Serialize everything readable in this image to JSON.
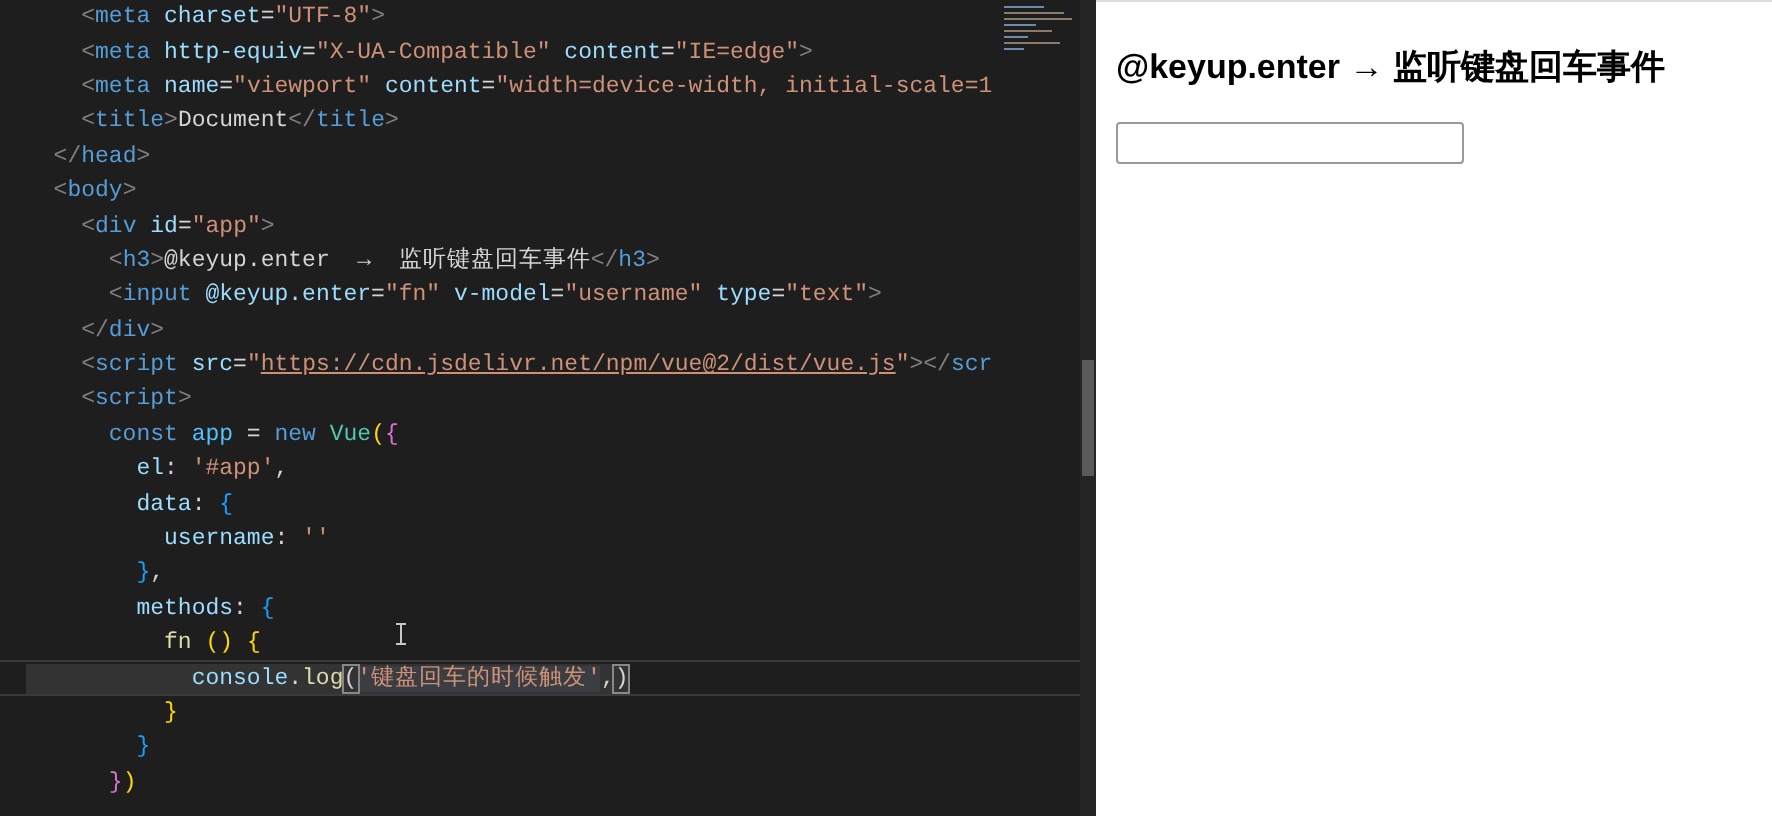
{
  "editor": {
    "lines": [
      {
        "current": false,
        "tokens": [
          {
            "kind": "punct",
            "text": "    <"
          },
          {
            "kind": "tag",
            "text": "meta"
          },
          {
            "kind": "attr",
            "text": " charset"
          },
          {
            "kind": "text",
            "text": "="
          },
          {
            "kind": "str",
            "text": "\"UTF-8\""
          },
          {
            "kind": "punct",
            "text": ">"
          }
        ]
      },
      {
        "current": false,
        "tokens": [
          {
            "kind": "punct",
            "text": "    <"
          },
          {
            "kind": "tag",
            "text": "meta"
          },
          {
            "kind": "attr",
            "text": " http-equiv"
          },
          {
            "kind": "text",
            "text": "="
          },
          {
            "kind": "str",
            "text": "\"X-UA-Compatible\""
          },
          {
            "kind": "attr",
            "text": " content"
          },
          {
            "kind": "text",
            "text": "="
          },
          {
            "kind": "str",
            "text": "\"IE=edge\""
          },
          {
            "kind": "punct",
            "text": ">"
          }
        ]
      },
      {
        "current": false,
        "tokens": [
          {
            "kind": "punct",
            "text": "    <"
          },
          {
            "kind": "tag",
            "text": "meta"
          },
          {
            "kind": "attr",
            "text": " name"
          },
          {
            "kind": "text",
            "text": "="
          },
          {
            "kind": "str",
            "text": "\"viewport\""
          },
          {
            "kind": "attr",
            "text": " content"
          },
          {
            "kind": "text",
            "text": "="
          },
          {
            "kind": "str",
            "text": "\"width=device-width, initial-scale=1"
          }
        ]
      },
      {
        "current": false,
        "tokens": [
          {
            "kind": "punct",
            "text": "    <"
          },
          {
            "kind": "tag",
            "text": "title"
          },
          {
            "kind": "punct",
            "text": ">"
          },
          {
            "kind": "text",
            "text": "Document"
          },
          {
            "kind": "punct",
            "text": "</"
          },
          {
            "kind": "tag",
            "text": "title"
          },
          {
            "kind": "punct",
            "text": ">"
          }
        ]
      },
      {
        "current": false,
        "tokens": [
          {
            "kind": "punct",
            "text": "  </"
          },
          {
            "kind": "tag",
            "text": "head"
          },
          {
            "kind": "punct",
            "text": ">"
          }
        ]
      },
      {
        "current": false,
        "tokens": [
          {
            "kind": "punct",
            "text": "  <"
          },
          {
            "kind": "tag",
            "text": "body"
          },
          {
            "kind": "punct",
            "text": ">"
          }
        ]
      },
      {
        "current": false,
        "tokens": [
          {
            "kind": "punct",
            "text": "    <"
          },
          {
            "kind": "tag",
            "text": "div"
          },
          {
            "kind": "attr",
            "text": " id"
          },
          {
            "kind": "text",
            "text": "="
          },
          {
            "kind": "str",
            "text": "\"app\""
          },
          {
            "kind": "punct",
            "text": ">"
          }
        ]
      },
      {
        "current": false,
        "tokens": [
          {
            "kind": "punct",
            "text": "      <"
          },
          {
            "kind": "tag",
            "text": "h3"
          },
          {
            "kind": "punct",
            "text": ">"
          },
          {
            "kind": "text",
            "text": "@keyup.enter  →  监听键盘回车事件"
          },
          {
            "kind": "punct",
            "text": "</"
          },
          {
            "kind": "tag",
            "text": "h3"
          },
          {
            "kind": "punct",
            "text": ">"
          }
        ]
      },
      {
        "current": false,
        "tokens": [
          {
            "kind": "punct",
            "text": "      <"
          },
          {
            "kind": "tag",
            "text": "input"
          },
          {
            "kind": "attr",
            "text": " @keyup.enter"
          },
          {
            "kind": "text",
            "text": "="
          },
          {
            "kind": "str",
            "text": "\"fn\""
          },
          {
            "kind": "attr",
            "text": " v-model"
          },
          {
            "kind": "text",
            "text": "="
          },
          {
            "kind": "str",
            "text": "\"username\""
          },
          {
            "kind": "attr",
            "text": " type"
          },
          {
            "kind": "text",
            "text": "="
          },
          {
            "kind": "str",
            "text": "\"text\""
          },
          {
            "kind": "punct",
            "text": ">"
          }
        ]
      },
      {
        "current": false,
        "tokens": [
          {
            "kind": "punct",
            "text": "    </"
          },
          {
            "kind": "tag",
            "text": "div"
          },
          {
            "kind": "punct",
            "text": ">"
          }
        ]
      },
      {
        "current": false,
        "tokens": [
          {
            "kind": "punct",
            "text": "    <"
          },
          {
            "kind": "tag",
            "text": "script"
          },
          {
            "kind": "attr",
            "text": " src"
          },
          {
            "kind": "text",
            "text": "="
          },
          {
            "kind": "str",
            "text": "\""
          },
          {
            "kind": "link",
            "text": "https://cdn.jsdelivr.net/npm/vue@2/dist/vue.js"
          },
          {
            "kind": "str",
            "text": "\""
          },
          {
            "kind": "punct",
            "text": "></"
          },
          {
            "kind": "tag",
            "text": "scr"
          }
        ]
      },
      {
        "current": false,
        "tokens": [
          {
            "kind": "punct",
            "text": "    <"
          },
          {
            "kind": "tag",
            "text": "script"
          },
          {
            "kind": "punct",
            "text": ">"
          }
        ]
      },
      {
        "current": false,
        "tokens": [
          {
            "kind": "keyword",
            "text": "      const"
          },
          {
            "kind": "var",
            "text": " app"
          },
          {
            "kind": "text",
            "text": " = "
          },
          {
            "kind": "keyword",
            "text": "new"
          },
          {
            "kind": "class",
            "text": " Vue"
          },
          {
            "kind": "brace1",
            "text": "("
          },
          {
            "kind": "brace2",
            "text": "{"
          }
        ]
      },
      {
        "current": false,
        "tokens": [
          {
            "kind": "prop",
            "text": "        el"
          },
          {
            "kind": "text",
            "text": ": "
          },
          {
            "kind": "str",
            "text": "'#app'"
          },
          {
            "kind": "text",
            "text": ","
          }
        ]
      },
      {
        "current": false,
        "tokens": [
          {
            "kind": "prop",
            "text": "        data"
          },
          {
            "kind": "text",
            "text": ": "
          },
          {
            "kind": "brace3",
            "text": "{"
          }
        ]
      },
      {
        "current": false,
        "tokens": [
          {
            "kind": "prop",
            "text": "          username"
          },
          {
            "kind": "text",
            "text": ": "
          },
          {
            "kind": "str",
            "text": "''"
          }
        ]
      },
      {
        "current": false,
        "tokens": [
          {
            "kind": "brace3",
            "text": "        }"
          },
          {
            "kind": "text",
            "text": ","
          }
        ]
      },
      {
        "current": false,
        "tokens": [
          {
            "kind": "prop",
            "text": "        methods"
          },
          {
            "kind": "text",
            "text": ": "
          },
          {
            "kind": "brace3",
            "text": "{"
          }
        ]
      },
      {
        "current": false,
        "tokens": [
          {
            "kind": "function",
            "text": "          fn"
          },
          {
            "kind": "brace1",
            "text": " ()"
          },
          {
            "kind": "brace1",
            "text": " {"
          }
        ]
      },
      {
        "current": true,
        "tokens": [
          {
            "kind": "prop",
            "text": "            console"
          },
          {
            "kind": "text",
            "text": "."
          },
          {
            "kind": "function",
            "text": "log"
          },
          {
            "kind": "bracket-match",
            "text": "("
          },
          {
            "kind": "selected-string",
            "text": "'键盘回车的时候触发'"
          },
          {
            "kind": "text",
            "text": ","
          },
          {
            "kind": "bracket-match",
            "text": ")"
          }
        ]
      },
      {
        "current": false,
        "tokens": [
          {
            "kind": "brace1",
            "text": "          }"
          }
        ]
      },
      {
        "current": false,
        "tokens": [
          {
            "kind": "brace3",
            "text": "        }"
          }
        ]
      },
      {
        "current": false,
        "tokens": [
          {
            "kind": "brace2",
            "text": "      }"
          },
          {
            "kind": "brace1",
            "text": ")"
          }
        ]
      }
    ]
  },
  "preview": {
    "heading": "@keyup.enter → 监听键盘回车事件",
    "input": {
      "kind": "text-input"
    }
  }
}
